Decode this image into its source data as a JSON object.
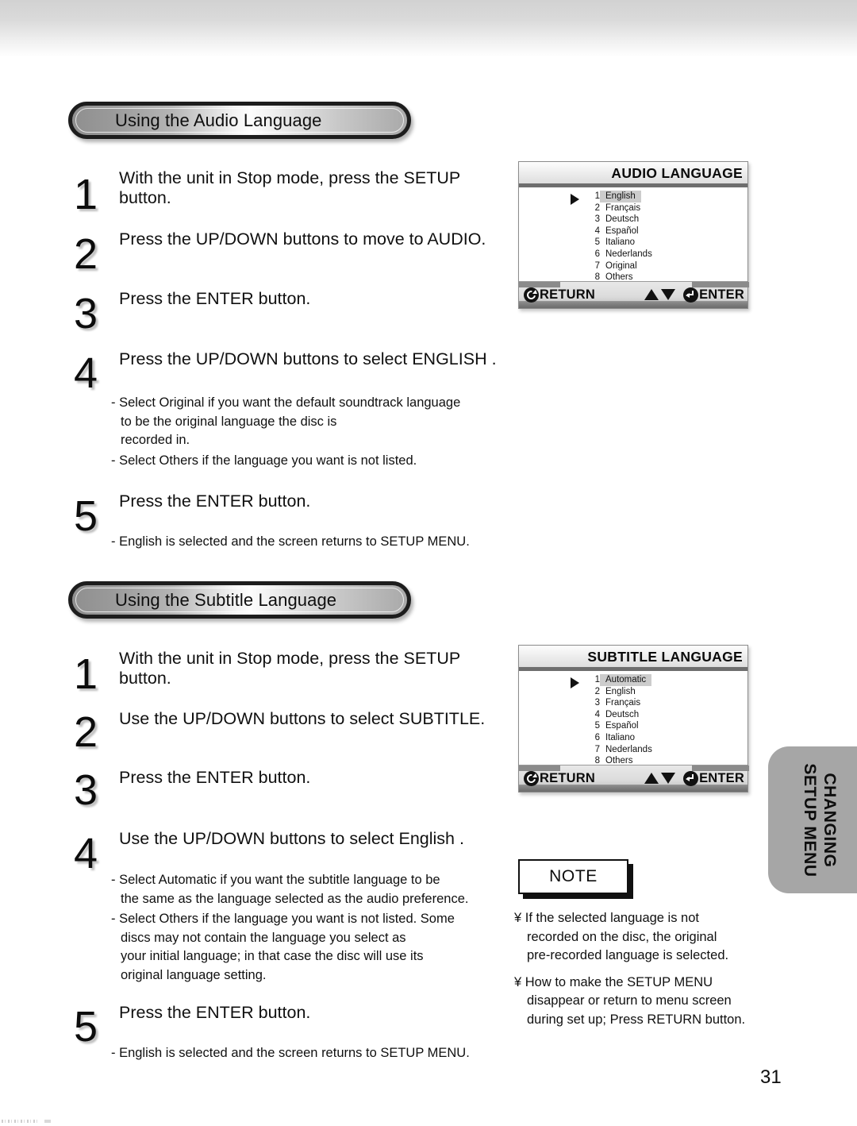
{
  "page": {
    "number": "31"
  },
  "side_tab": {
    "line1": "CHANGING",
    "line2": "SETUP MENU"
  },
  "sections": [
    {
      "heading": "Using the Audio Language",
      "steps": [
        {
          "num": "1",
          "text": "With the unit in Stop mode, press the SETUP\nbutton."
        },
        {
          "num": "2",
          "text": "Press the UP/DOWN buttons to move to AUDIO."
        },
        {
          "num": "3",
          "text": "Press the ENTER button."
        },
        {
          "num": "4",
          "text": "Press the UP/DOWN buttons to select  ENGLISH ."
        },
        {
          "num": "5",
          "text": "Press the ENTER button."
        }
      ],
      "notes_after_step4": [
        "- Select  Original  if you want the default soundtrack language\n   to be the original language the disc is\n   recorded in.",
        "- Select  Others  if the language you want is not listed."
      ],
      "notes_after_step5": [
        "- English is selected and the screen returns to SETUP MENU."
      ]
    },
    {
      "heading": "Using the Subtitle Language",
      "steps": [
        {
          "num": "1",
          "text": "With the unit in Stop mode, press the SETUP\nbutton."
        },
        {
          "num": "2",
          "text": "Use the UP/DOWN buttons to select SUBTITLE."
        },
        {
          "num": "3",
          "text": "Press the ENTER button."
        },
        {
          "num": "4",
          "text": "Use the UP/DOWN buttons to select  English ."
        },
        {
          "num": "5",
          "text": "Press the ENTER button."
        }
      ],
      "notes_after_step4": [
        "- Select  Automatic  if you want the subtitle language to be\n   the same as the language selected as the audio preference.",
        "- Select  Others  if the language you want is not listed. Some\n   discs may not contain the language you select as\n   your initial language; in that case the disc will use its\n   original language setting."
      ],
      "notes_after_step5": [
        "- English is selected and the screen returns to SETUP MENU."
      ]
    }
  ],
  "osd_screens": [
    {
      "title": "AUDIO LANGUAGE",
      "items": [
        {
          "n": "1",
          "label": "English",
          "selected": true
        },
        {
          "n": "2",
          "label": "Français",
          "selected": false
        },
        {
          "n": "3",
          "label": "Deutsch",
          "selected": false
        },
        {
          "n": "4",
          "label": "Español",
          "selected": false
        },
        {
          "n": "5",
          "label": "Italiano",
          "selected": false
        },
        {
          "n": "6",
          "label": "Nederlands",
          "selected": false
        },
        {
          "n": "7",
          "label": "Original",
          "selected": false
        },
        {
          "n": "8",
          "label": "Others",
          "selected": false
        }
      ],
      "footer": {
        "return_label": "RETURN",
        "enter_label": "ENTER"
      }
    },
    {
      "title": "SUBTITLE LANGUAGE",
      "items": [
        {
          "n": "1",
          "label": "Automatic",
          "selected": true
        },
        {
          "n": "2",
          "label": "English",
          "selected": false
        },
        {
          "n": "3",
          "label": "Français",
          "selected": false
        },
        {
          "n": "4",
          "label": "Deutsch",
          "selected": false
        },
        {
          "n": "5",
          "label": "Español",
          "selected": false
        },
        {
          "n": "6",
          "label": "Italiano",
          "selected": false
        },
        {
          "n": "7",
          "label": "Nederlands",
          "selected": false
        },
        {
          "n": "8",
          "label": "Others",
          "selected": false
        }
      ],
      "footer": {
        "return_label": "RETURN",
        "enter_label": "ENTER"
      }
    }
  ],
  "note_box": {
    "label": "NOTE",
    "bullets": [
      "¥ If the selected language is not\n   recorded on the disc, the original\n   pre-recorded language is selected.",
      "¥ How to make the SETUP MENU\n   disappear or return to menu screen\n   during set up; Press RETURN button."
    ]
  }
}
